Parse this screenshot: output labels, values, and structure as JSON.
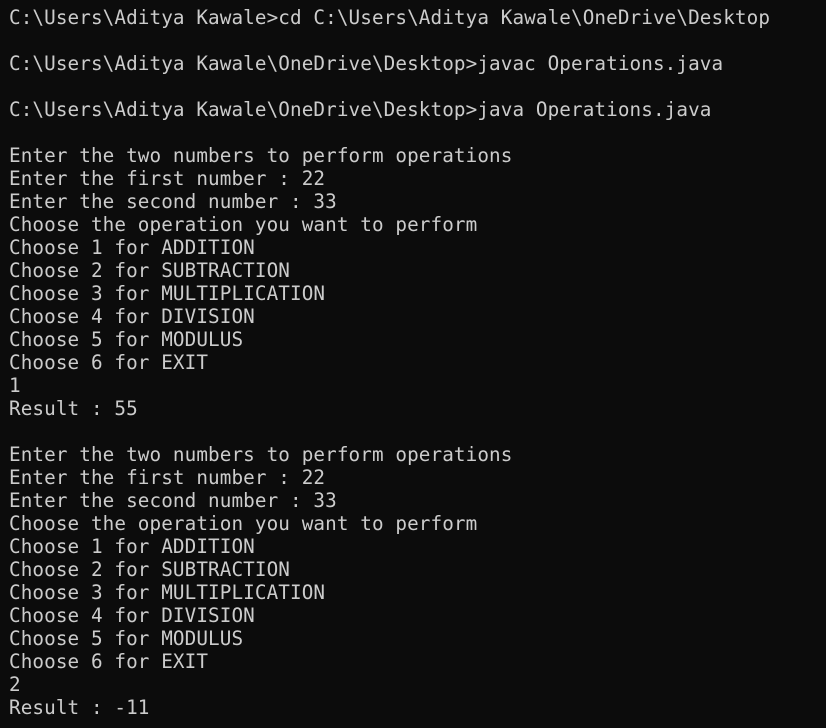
{
  "terminal": {
    "lines": [
      "C:\\Users\\Aditya Kawale>cd C:\\Users\\Aditya Kawale\\OneDrive\\Desktop",
      "",
      "C:\\Users\\Aditya Kawale\\OneDrive\\Desktop>javac Operations.java",
      "",
      "C:\\Users\\Aditya Kawale\\OneDrive\\Desktop>java Operations.java",
      "",
      "Enter the two numbers to perform operations",
      "Enter the first number : 22",
      "Enter the second number : 33",
      "Choose the operation you want to perform",
      "Choose 1 for ADDITION",
      "Choose 2 for SUBTRACTION",
      "Choose 3 for MULTIPLICATION",
      "Choose 4 for DIVISION",
      "Choose 5 for MODULUS",
      "Choose 6 for EXIT",
      "1",
      "Result : 55",
      "",
      "Enter the two numbers to perform operations",
      "Enter the first number : 22",
      "Enter the second number : 33",
      "Choose the operation you want to perform",
      "Choose 1 for ADDITION",
      "Choose 2 for SUBTRACTION",
      "Choose 3 for MULTIPLICATION",
      "Choose 4 for DIVISION",
      "Choose 5 for MODULUS",
      "Choose 6 for EXIT",
      "2",
      "Result : -11"
    ]
  }
}
